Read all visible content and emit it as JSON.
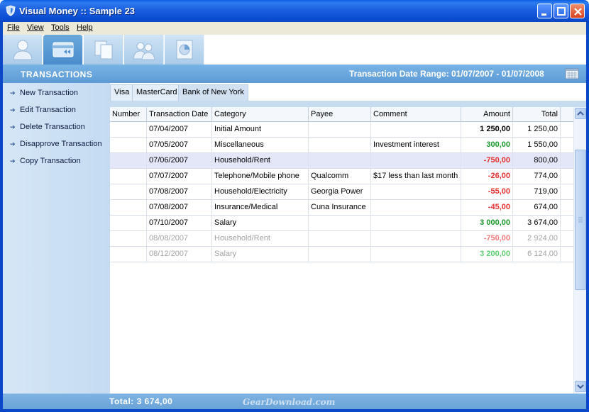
{
  "window": {
    "title": "Visual Money :: Sample 23"
  },
  "menu": [
    "File",
    "View",
    "Tools",
    "Help"
  ],
  "toolbar": {
    "buttons": [
      "contacts-icon",
      "transactions-icon",
      "accounts-icon",
      "users-icon",
      "reports-icon"
    ],
    "active_index": 1
  },
  "header": {
    "section_title": "TRANSACTIONS",
    "date_range": "Transaction Date Range: 01/07/2007 - 01/07/2008"
  },
  "sidebar": {
    "items": [
      "New Transaction",
      "Edit Transaction",
      "Delete Transaction",
      "Disapprove Transaction",
      "Copy Transaction"
    ]
  },
  "account_tabs": {
    "items": [
      "Visa",
      "MasterCard",
      "Bank of New York"
    ],
    "active_index": 2
  },
  "grid": {
    "columns": [
      "Number",
      "Transaction Date",
      "Category",
      "Payee",
      "Comment",
      "Amount",
      "Total"
    ],
    "rows": [
      {
        "number": "",
        "date": "07/04/2007",
        "category": "Initial Amount",
        "payee": "",
        "comment": "",
        "amount": "1 250,00",
        "total": "1 250,00",
        "kind": "neutral",
        "state": "normal"
      },
      {
        "number": "",
        "date": "07/05/2007",
        "category": "Miscellaneous",
        "payee": "",
        "comment": "Investment interest",
        "amount": "300,00",
        "total": "1 550,00",
        "kind": "pos",
        "state": "normal"
      },
      {
        "number": "",
        "date": "07/06/2007",
        "category": "Household/Rent",
        "payee": "",
        "comment": "",
        "amount": "-750,00",
        "total": "800,00",
        "kind": "neg",
        "state": "selected"
      },
      {
        "number": "",
        "date": "07/07/2007",
        "category": "Telephone/Mobile phone",
        "payee": "Qualcomm",
        "comment": "$17 less than last month",
        "amount": "-26,00",
        "total": "774,00",
        "kind": "neg",
        "state": "normal"
      },
      {
        "number": "",
        "date": "07/08/2007",
        "category": "Household/Electricity",
        "payee": "Georgia Power",
        "comment": "",
        "amount": "-55,00",
        "total": "719,00",
        "kind": "neg",
        "state": "normal"
      },
      {
        "number": "",
        "date": "07/08/2007",
        "category": "Insurance/Medical",
        "payee": "Cuna Insurance",
        "comment": "",
        "amount": "-45,00",
        "total": "674,00",
        "kind": "neg",
        "state": "normal"
      },
      {
        "number": "",
        "date": "07/10/2007",
        "category": "Salary",
        "payee": "",
        "comment": "",
        "amount": "3 000,00",
        "total": "3 674,00",
        "kind": "pos",
        "state": "normal"
      },
      {
        "number": "",
        "date": "08/08/2007",
        "category": "Household/Rent",
        "payee": "",
        "comment": "",
        "amount": "-750,00",
        "total": "2 924,00",
        "kind": "neg",
        "state": "future"
      },
      {
        "number": "",
        "date": "08/12/2007",
        "category": "Salary",
        "payee": "",
        "comment": "",
        "amount": "3 200,00",
        "total": "6 124,00",
        "kind": "pos",
        "state": "future"
      }
    ]
  },
  "status": {
    "total": "Total: 3 674,00",
    "watermark": "GearDownload.com"
  }
}
